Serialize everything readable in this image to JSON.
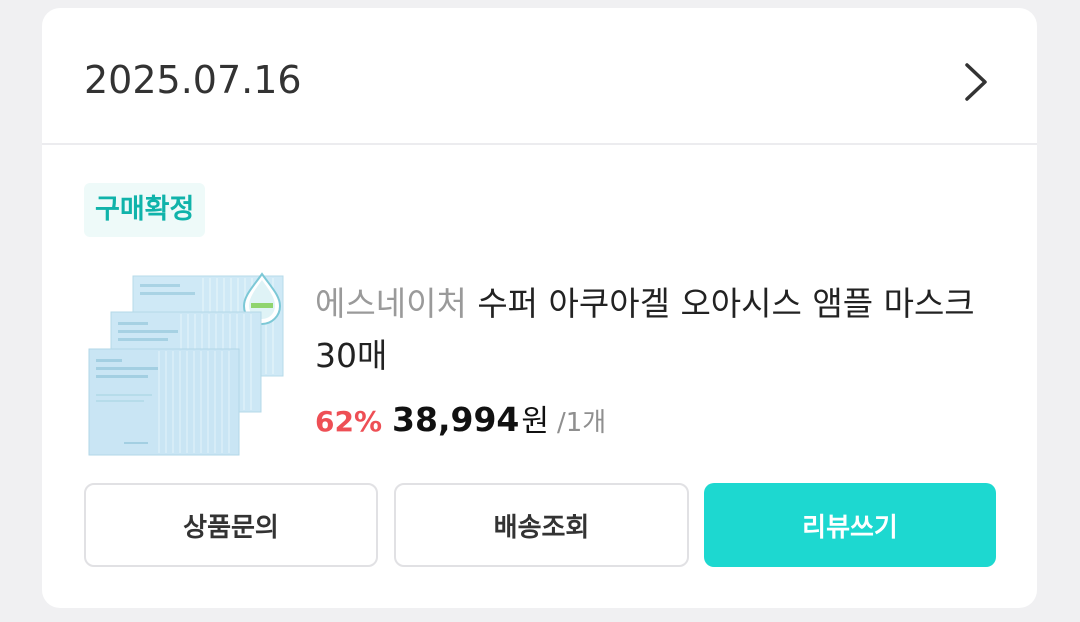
{
  "order": {
    "date": "2025.07.16",
    "status": "구매확정",
    "chevron_icon": "chevron-right-icon"
  },
  "product": {
    "brand": "에스네이처",
    "name": "수퍼 아쿠아겔 오아시스 앰플 마스크 30매",
    "discount": "62%",
    "price": "38,994",
    "currency": "원",
    "quantity": "/1개",
    "image_icon": "product-mask-pack-image"
  },
  "actions": {
    "inquiry_label": "상품문의",
    "tracking_label": "배송조회",
    "review_label": "리뷰쓰기"
  },
  "colors": {
    "accent": "#1dd8d0",
    "status_text": "#10b3aa",
    "discount": "#ee4f55"
  }
}
